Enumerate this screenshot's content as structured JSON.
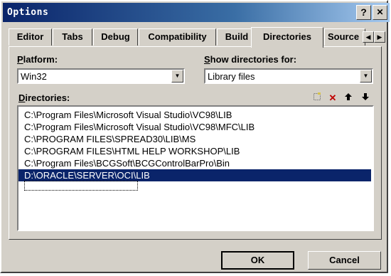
{
  "window": {
    "title": "Options"
  },
  "titlebar_buttons": {
    "help": "?",
    "close": "✕"
  },
  "tabs": [
    {
      "label": "Editor"
    },
    {
      "label": "Tabs"
    },
    {
      "label": "Debug"
    },
    {
      "label": "Compatibility"
    },
    {
      "label": "Build"
    },
    {
      "label": "Directories",
      "active": true
    },
    {
      "label": "Source"
    }
  ],
  "platform": {
    "label_prefix": "P",
    "label_rest": "latform:",
    "value": "Win32"
  },
  "show_dirs": {
    "label_prefix": "S",
    "label_rest": "how directories for:",
    "value": "Library files"
  },
  "directories": {
    "label_prefix": "D",
    "label_rest": "irectories:",
    "items": [
      "C:\\Program Files\\Microsoft Visual Studio\\VC98\\LIB",
      "C:\\Program Files\\Microsoft Visual Studio\\VC98\\MFC\\LIB",
      "C:\\PROGRAM FILES\\SPREAD30\\LIB\\MS",
      "C:\\PROGRAM FILES\\HTML HELP WORKSHOP\\LIB",
      "C:\\Program Files\\BCGSoft\\BCGControlBarPro\\Bin",
      "D:\\ORACLE\\SERVER\\OCI\\LIB"
    ],
    "selected_index": 5
  },
  "buttons": {
    "ok": "OK",
    "cancel": "Cancel"
  },
  "icons": {
    "new": "new-folder-icon",
    "delete": "delete-icon",
    "up": "move-up-icon",
    "down": "move-down-icon"
  },
  "colors": {
    "title_start": "#0a246a",
    "title_end": "#a6caf0",
    "selection": "#0a246a",
    "face": "#d4d0c8"
  }
}
